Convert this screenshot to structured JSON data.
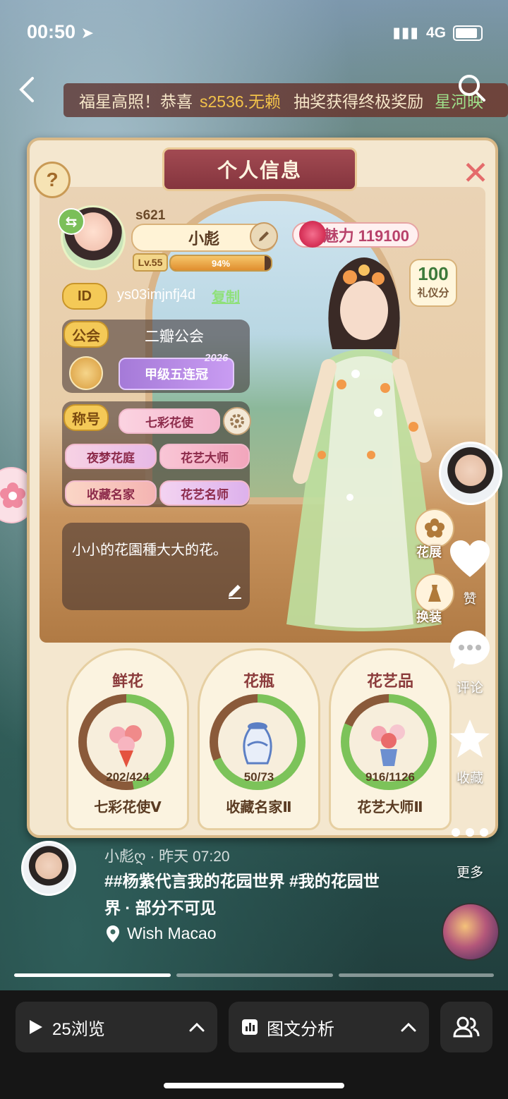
{
  "status_bar": {
    "time": "00:50",
    "network": "4G"
  },
  "marquee": {
    "part1": "福星高照！恭喜",
    "highlight": "s2536.无赖",
    "part2": "抽奖获得终极奖励",
    "tail": "星河映"
  },
  "panel": {
    "title": "个人信息"
  },
  "profile": {
    "server": "s621",
    "name": "小彪",
    "level": "Lv.55",
    "xp_percent": "94%",
    "xp_fraction": 0.94,
    "charm": "魅力 119100",
    "etiquette_score": "100",
    "etiquette_label": "礼仪分",
    "id_label": "ID",
    "id_value": "ys03imjnfj4d",
    "copy_label": "复制",
    "guild_label": "公会",
    "guild_name": "二瓣公会",
    "guild_honor": "甲级五连冠",
    "guild_honor_year": "2026",
    "title_label": "称号",
    "titles": [
      "七彩花使",
      "夜梦花庭",
      "花艺大师",
      "收藏名家",
      "花艺名师"
    ],
    "bio": "小小的花園種大大的花。"
  },
  "side_actions": [
    {
      "label": "花展",
      "icon": "flower-icon"
    },
    {
      "label": "换装",
      "icon": "dress-icon"
    }
  ],
  "stats": [
    {
      "title": "鲜花",
      "count": "202/424",
      "level": "七彩花使Ⅴ",
      "progress": 0.476
    },
    {
      "title": "花瓶",
      "count": "50/73",
      "level": "收藏名家Ⅱ",
      "progress": 0.685
    },
    {
      "title": "花艺品",
      "count": "916/1126",
      "level": "花艺大师Ⅱ",
      "progress": 0.813
    }
  ],
  "feed_actions": [
    {
      "label": "赞",
      "icon": "heart-icon"
    },
    {
      "label": "评论",
      "icon": "comment-icon"
    },
    {
      "label": "收藏",
      "icon": "star-icon"
    },
    {
      "label": "更多",
      "icon": "more-icon"
    }
  ],
  "post": {
    "author": "小彪ღ · 昨天 07:20",
    "caption": "##杨紫代言我的花园世界 #我的花园世界 · 部分不可见",
    "location": "Wish Macao"
  },
  "bottom_bar": {
    "views": "25浏览",
    "analysis": "图文分析"
  },
  "colors": {
    "accent_gold": "#f4c957",
    "marquee_highlight": "#f2c24a",
    "copy_green": "#8fe07a"
  }
}
